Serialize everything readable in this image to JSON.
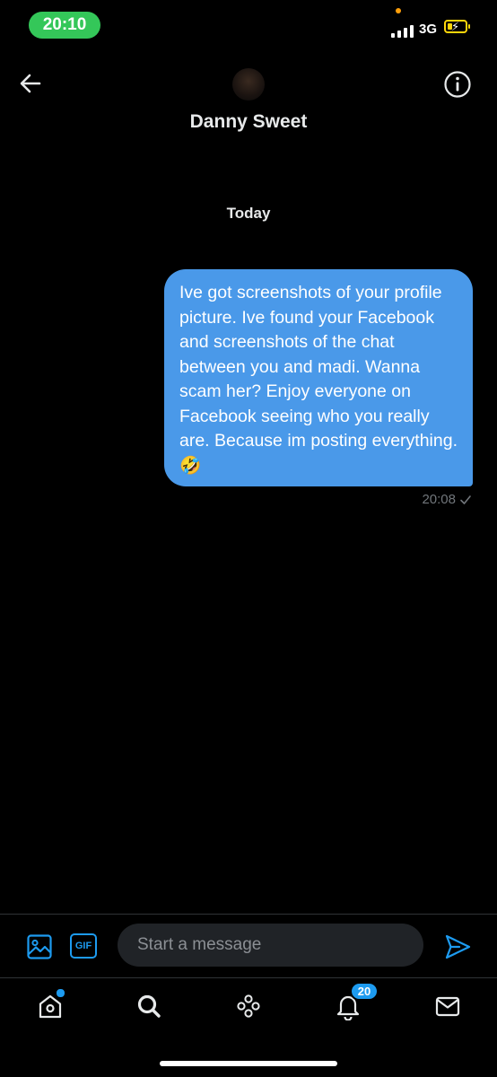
{
  "status_bar": {
    "time": "20:10",
    "network": "3G",
    "signal_bars": 4,
    "battery_charging": true,
    "colors": {
      "time_pill": "#34c759",
      "battery": "#ffd60a"
    }
  },
  "header": {
    "back_icon": "arrow-left-icon",
    "contact_name": "Danny Sweet",
    "info_icon": "info-circle-icon"
  },
  "conversation": {
    "date_separator": "Today",
    "messages": [
      {
        "direction": "outgoing",
        "text": "Ive got screenshots of your profile picture. Ive found your Facebook and screenshots of the chat between you and madi. Wanna scam her? Enjoy everyone on Facebook seeing who you really are. Because im posting everything. 🤣",
        "time": "20:08",
        "status_icon": "checkmark-icon",
        "bubble_color": "#4a99e9"
      }
    ]
  },
  "composer": {
    "media_icon": "image-icon",
    "gif_label": "GIF",
    "placeholder": "Start a message",
    "value": "",
    "send_icon": "send-icon",
    "accent_color": "#1d9bf0"
  },
  "tabbar": {
    "items": [
      {
        "name": "home",
        "icon": "home-icon",
        "has_dot": true
      },
      {
        "name": "search",
        "icon": "search-icon"
      },
      {
        "name": "spaces",
        "icon": "spaces-icon"
      },
      {
        "name": "notifications",
        "icon": "bell-icon",
        "badge": "20"
      },
      {
        "name": "messages",
        "icon": "envelope-icon"
      }
    ]
  }
}
